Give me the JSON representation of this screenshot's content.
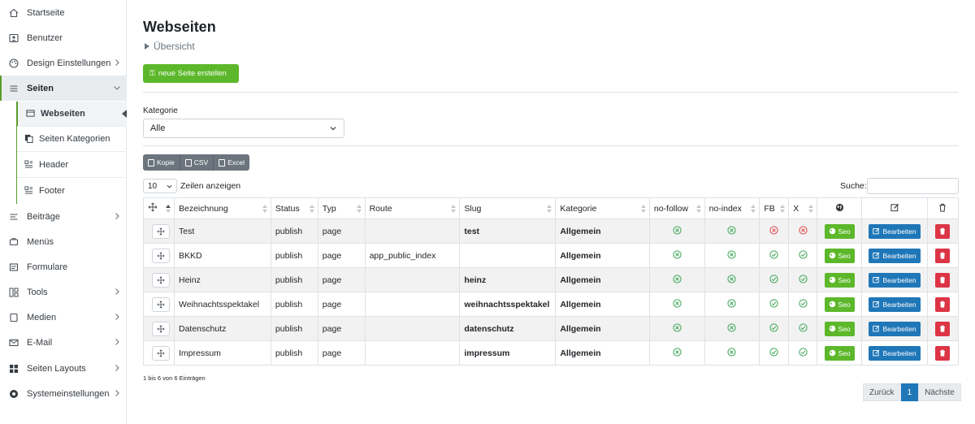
{
  "sidebar": {
    "items": [
      {
        "label": "Startseite",
        "icon": "home-icon"
      },
      {
        "label": "Benutzer",
        "icon": "user-icon"
      },
      {
        "label": "Design Einstellungen",
        "icon": "palette-icon"
      },
      {
        "label": "Seiten",
        "icon": "list-icon"
      },
      {
        "label": "Beiträge",
        "icon": "text-icon"
      },
      {
        "label": "Menüs",
        "icon": "menu-icon"
      },
      {
        "label": "Formulare",
        "icon": "form-icon"
      },
      {
        "label": "Tools",
        "icon": "tools-icon"
      },
      {
        "label": "Medien",
        "icon": "media-icon"
      },
      {
        "label": "E-Mail",
        "icon": "mail-icon"
      },
      {
        "label": "Seiten Layouts",
        "icon": "grid-icon"
      },
      {
        "label": "Systemeinstellungen",
        "icon": "settings-icon"
      }
    ],
    "sub_items": [
      {
        "label": "Webseiten"
      },
      {
        "label": "Seiten Kategorien"
      },
      {
        "label": "Header"
      },
      {
        "label": "Footer"
      }
    ]
  },
  "page": {
    "title": "Webseiten",
    "breadcrumb": "Übersicht",
    "new_button": "neue Seite erstellen"
  },
  "filter": {
    "label": "Kategorie",
    "value": "Alle"
  },
  "export": {
    "copy": "Kopie",
    "csv": "CSV",
    "excel": "Excel"
  },
  "table_controls": {
    "length_value": "10",
    "length_label": "Zeilen anzeigen",
    "search_label": "Suche:"
  },
  "table": {
    "headers": [
      "Bezeichnung",
      "Status",
      "Typ",
      "Route",
      "Slug",
      "Kategorie",
      "no-follow",
      "no-index",
      "FB",
      "X"
    ],
    "rows": [
      {
        "name": "Test",
        "status": "publish",
        "type": "page",
        "route": "",
        "slug": "test",
        "category": "Allgemein",
        "fb": "no",
        "x": "no"
      },
      {
        "name": "BKKD",
        "status": "publish",
        "type": "page",
        "route": "app_public_index",
        "slug": "",
        "category": "Allgemein",
        "fb": "yes",
        "x": "yes"
      },
      {
        "name": "Heinz",
        "status": "publish",
        "type": "page",
        "route": "",
        "slug": "heinz",
        "category": "Allgemein",
        "fb": "yes",
        "x": "yes"
      },
      {
        "name": "Weihnachtsspektakel",
        "status": "publish",
        "type": "page",
        "route": "",
        "slug": "weihnachtsspektakel",
        "category": "Allgemein",
        "fb": "yes",
        "x": "yes"
      },
      {
        "name": "Datenschutz",
        "status": "publish",
        "type": "page",
        "route": "",
        "slug": "datenschutz",
        "category": "Allgemein",
        "fb": "yes",
        "x": "yes"
      },
      {
        "name": "Impressum",
        "status": "publish",
        "type": "page",
        "route": "",
        "slug": "impressum",
        "category": "Allgemein",
        "fb": "yes",
        "x": "yes"
      }
    ],
    "seo_label": "Seo",
    "edit_label": "Bearbeiten"
  },
  "footer": {
    "info": "1 bis 6 von 6 Einträgen",
    "prev": "Zurück",
    "page": "1",
    "next": "Nächste"
  },
  "colors": {
    "accent_green": "#5cb82a",
    "edit_blue": "#1f77b8",
    "delete_red": "#dc3545",
    "ok_green": "#3aa655",
    "no_red": "#e0474c"
  }
}
